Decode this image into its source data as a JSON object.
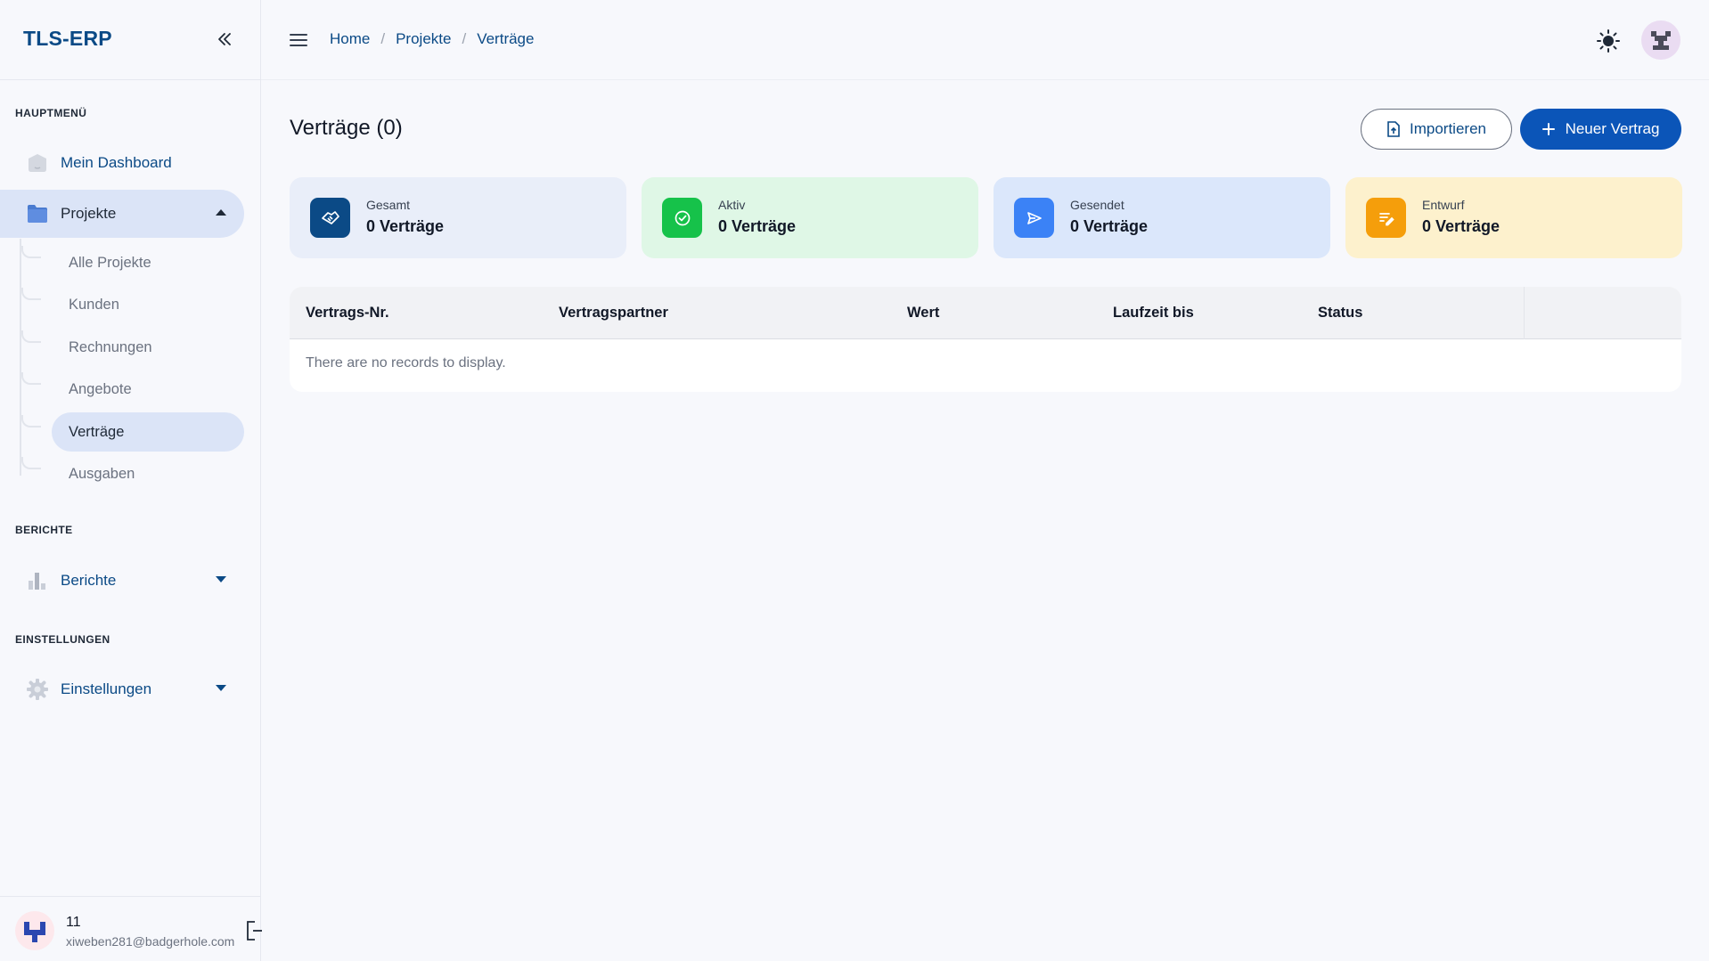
{
  "app": {
    "brand": "TLS-ERP"
  },
  "sidebar": {
    "sections": [
      {
        "title": "HAUPTMENÜ"
      },
      {
        "title": "BERICHTE"
      },
      {
        "title": "EINSTELLUNGEN"
      }
    ],
    "items": [
      {
        "label": "Mein Dashboard",
        "icon": "home-icon"
      },
      {
        "label": "Projekte",
        "icon": "folder-icon",
        "expanded": true
      },
      {
        "label": "Berichte",
        "icon": "bar-chart-icon"
      },
      {
        "label": "Einstellungen",
        "icon": "gear-icon"
      }
    ],
    "sub_items": [
      {
        "label": "Alle Projekte"
      },
      {
        "label": "Kunden"
      },
      {
        "label": "Rechnungen"
      },
      {
        "label": "Angebote"
      },
      {
        "label": "Verträge",
        "active": true
      },
      {
        "label": "Ausgaben"
      }
    ],
    "user": {
      "name": "11",
      "email": "xiweben281@badgerhole.com"
    }
  },
  "breadcrumb": [
    {
      "label": "Home"
    },
    {
      "label": "Projekte"
    },
    {
      "label": "Verträge"
    }
  ],
  "page": {
    "title": "Verträge (0)",
    "import_label": "Importieren",
    "new_label": "Neuer Vertrag"
  },
  "stats": [
    {
      "label": "Gesamt",
      "value": "0 Verträge",
      "color": "#0b4a86",
      "bg": "#e9eef9"
    },
    {
      "label": "Aktiv",
      "value": "0 Verträge",
      "color": "#16c24a",
      "bg": "#dff7e6"
    },
    {
      "label": "Gesendet",
      "value": "0 Verträge",
      "color": "#3b82f6",
      "bg": "#dbe7fb"
    },
    {
      "label": "Entwurf",
      "value": "0 Verträge",
      "color": "#f59e0b",
      "bg": "#fdf1cd"
    }
  ],
  "table": {
    "columns": [
      "Vertrags-Nr.",
      "Vertragspartner",
      "Wert",
      "Laufzeit bis",
      "Status"
    ],
    "empty_message": "There are no records to display."
  },
  "colors": {
    "brand": "#0b4a86",
    "primary": "#0b55b8",
    "active_bg": "#dbe4f7"
  }
}
